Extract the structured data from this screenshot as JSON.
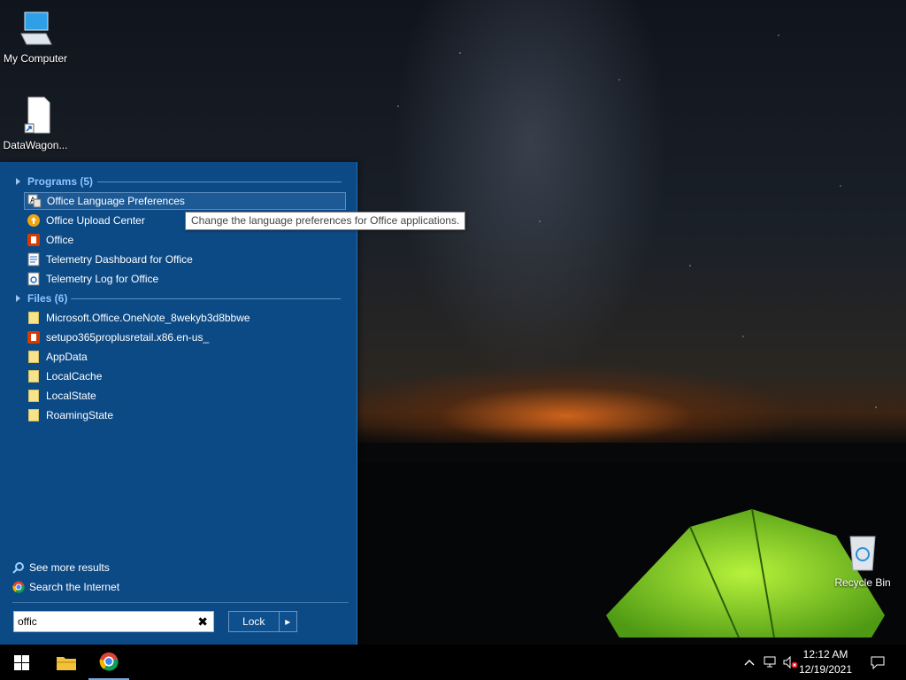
{
  "desktop": {
    "icons": [
      {
        "label": "My Computer",
        "icon": "computer-icon"
      },
      {
        "label": "DataWagon...",
        "icon": "shortcut-file-icon"
      },
      {
        "label": "Recycle Bin",
        "icon": "recycle-bin-icon"
      }
    ]
  },
  "start_panel": {
    "groups": [
      {
        "title": "Programs (5)"
      },
      {
        "title": "Files (6)"
      }
    ],
    "programs": [
      {
        "label": "Office Language Preferences",
        "icon": "language-icon"
      },
      {
        "label": "Office Upload Center",
        "icon": "upload-center-icon"
      },
      {
        "label": "Office",
        "icon": "office-icon"
      },
      {
        "label": "Telemetry Dashboard for Office",
        "icon": "dashboard-icon"
      },
      {
        "label": "Telemetry Log for Office",
        "icon": "log-icon"
      }
    ],
    "files": [
      {
        "label": "Microsoft.Office.OneNote_8wekyb3d8bbwe",
        "icon": "folder-icon"
      },
      {
        "label": "setupo365proplusretail.x86.en-us_",
        "icon": "office-setup-icon"
      },
      {
        "label": "AppData",
        "icon": "folder-icon"
      },
      {
        "label": "LocalCache",
        "icon": "folder-icon"
      },
      {
        "label": "LocalState",
        "icon": "folder-icon"
      },
      {
        "label": "RoamingState",
        "icon": "folder-icon"
      }
    ],
    "tooltip": "Change the language preferences for Office applications.",
    "see_more": "See more results",
    "search_internet": "Search the Internet",
    "search": {
      "value": "offic",
      "placeholder": ""
    },
    "clear_symbol": "✖",
    "lock_label": "Lock",
    "lock_arrow": "▸"
  },
  "taskbar": {
    "time": "12:12 AM",
    "date": "12/19/2021",
    "apps": [
      "start-icon",
      "file-explorer-icon",
      "chrome-icon"
    ]
  },
  "colors": {
    "panel": "#0c4a86",
    "group_title": "#8ec3ff",
    "selection": "#1d5a95"
  }
}
